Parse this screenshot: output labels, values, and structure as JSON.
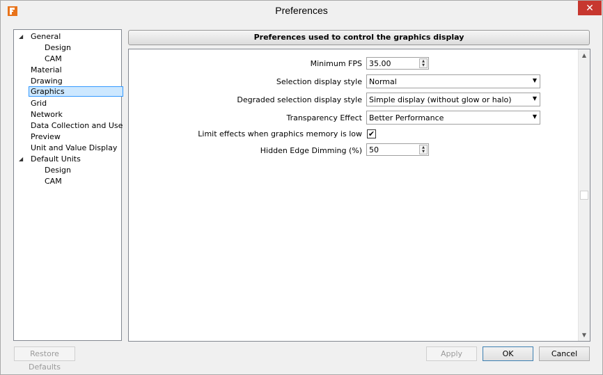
{
  "window": {
    "title": "Preferences",
    "close_glyph": "✕"
  },
  "tree": {
    "items": [
      {
        "label": "General",
        "expanded": true
      },
      {
        "label": "Design"
      },
      {
        "label": "CAM"
      },
      {
        "label": "Material"
      },
      {
        "label": "Drawing"
      },
      {
        "label": "Graphics",
        "selected": true
      },
      {
        "label": "Grid"
      },
      {
        "label": "Network"
      },
      {
        "label": "Data Collection and Use"
      },
      {
        "label": "Preview"
      },
      {
        "label": "Unit and Value Display"
      },
      {
        "label": "Default Units",
        "expanded": true
      },
      {
        "label": "Design"
      },
      {
        "label": "CAM"
      }
    ],
    "expander_glyph": "◢"
  },
  "panel": {
    "header": "Preferences used to control the graphics display",
    "min_fps": {
      "label": "Minimum FPS",
      "value": "35.00"
    },
    "selection_style": {
      "label": "Selection display style",
      "value": "Normal"
    },
    "degraded_style": {
      "label": "Degraded selection display style",
      "value": "Simple display (without glow or halo)"
    },
    "transparency": {
      "label": "Transparency Effect",
      "value": "Better Performance"
    },
    "limit_effects": {
      "label": "Limit effects when graphics memory is low",
      "checked": true,
      "check_glyph": "✔"
    },
    "edge_dimming": {
      "label": "Hidden Edge Dimming (%)",
      "value": "50"
    },
    "glyphs": {
      "up": "▲",
      "down": "▼"
    }
  },
  "buttons": {
    "restore": "Restore Defaults",
    "apply": "Apply",
    "ok": "OK",
    "cancel": "Cancel"
  },
  "colors": {
    "close": "#c7372f",
    "selection": "#cde8ff"
  }
}
